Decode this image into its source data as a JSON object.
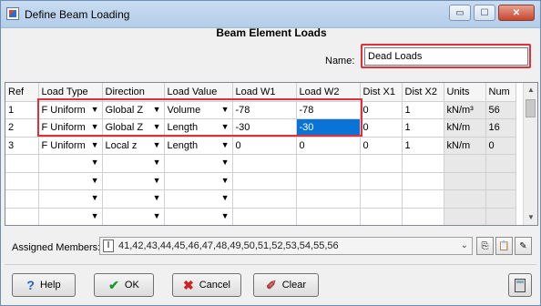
{
  "window": {
    "title": "Define Beam Loading",
    "controls": {
      "minimize": "▭",
      "maximize": "☐",
      "close": "✕"
    }
  },
  "dialog": {
    "heading": "Beam Element Loads",
    "name_label": "Name:",
    "name_value": "Dead Loads"
  },
  "grid": {
    "columns": [
      "Ref",
      "Load Type",
      "Direction",
      "Load Value",
      "Load W1",
      "Load W2",
      "Dist X1",
      "Dist X2",
      "Units",
      "Num"
    ],
    "rows": [
      [
        "1",
        "F Uniform",
        "Global Z",
        "Volume",
        "-78",
        "-78",
        "0",
        "1",
        "kN/m³",
        "56"
      ],
      [
        "2",
        "F Uniform",
        "Global Z",
        "Length",
        "-30",
        "-30",
        "0",
        "1",
        "kN/m",
        "16"
      ],
      [
        "3",
        "F Uniform",
        "Local z",
        "Length",
        "0",
        "0",
        "0",
        "1",
        "kN/m",
        "0"
      ],
      [
        "",
        "",
        "",
        "",
        "",
        "",
        "",
        "",
        "",
        ""
      ],
      [
        "",
        "",
        "",
        "",
        "",
        "",
        "",
        "",
        "",
        ""
      ],
      [
        "",
        "",
        "",
        "",
        "",
        "",
        "",
        "",
        "",
        ""
      ],
      [
        "",
        "",
        "",
        "",
        "",
        "",
        "",
        "",
        "",
        ""
      ]
    ],
    "selected_cell_value": "-30"
  },
  "assigned": {
    "label": "Assigned Members:",
    "value": "41,42,43,44,45,46,47,48,49,50,51,52,53,54,55,56"
  },
  "buttons": {
    "help": "Help",
    "ok": "OK",
    "cancel": "Cancel",
    "clear": "Clear"
  },
  "colors": {
    "highlight": "#e0303c",
    "selection": "#0a74d6"
  }
}
